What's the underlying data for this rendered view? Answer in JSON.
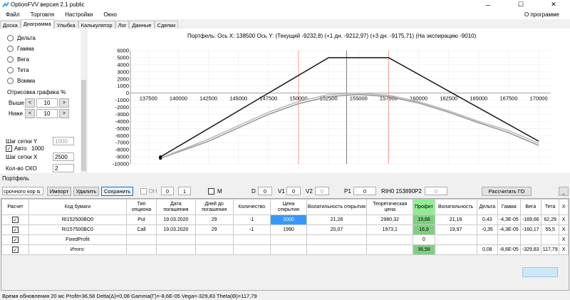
{
  "titlebar": {
    "title": "OptionFVV версия 2.1 public",
    "minimize": "─",
    "maximize": "☐",
    "close": "✕"
  },
  "menu": {
    "file": "Файл",
    "trade": "Торговля",
    "settings": "Настройки",
    "window": "Окно",
    "about": "О программе"
  },
  "tabs": [
    "Доска",
    "Диаграмма",
    "Улыбка",
    "Калькулятор",
    "Лог",
    "Данные",
    "Сделки"
  ],
  "left": {
    "radios": [
      "Дельта",
      "Гамма",
      "Вега",
      "Тета",
      "Вомма"
    ],
    "draw_title": "Отрисовка графика %",
    "above_label": "Выше",
    "above_value": "10",
    "below_label": "Ниже",
    "below_value": "10",
    "spin_left": "<",
    "spin_right": ">",
    "gridy_label": "Шаг сетки Y",
    "gridy_value": "1000",
    "auto_label": "Авто",
    "auto_value": "1000",
    "gridx_label": "Шаг сетки X",
    "gridx_value": "2500",
    "sko_label": "Кол-во СКО",
    "sko_value": "2"
  },
  "chart_title": "Портфель: Ось X: 138500 Ось Y: (Текущий -9232,8)  (+1 дн. -9212,97)  (+3 дн. -9175,71)  (На экспирацию -9010)",
  "chart_data": {
    "type": "line",
    "x_ticks": [
      137500,
      140000,
      142500,
      145000,
      147500,
      150000,
      152500,
      155000,
      157500,
      160000,
      162500,
      165000,
      167500,
      170000
    ],
    "y_ticks": [
      6000,
      5000,
      4000,
      3000,
      2000,
      1000,
      0,
      -1000,
      -2000,
      -3000,
      -4000,
      -5000,
      -6000,
      -7000,
      -8000,
      -9000,
      -10000
    ],
    "xlim": [
      136000,
      171000
    ],
    "ylim": [
      -10000,
      6000
    ],
    "cursor_x": 154000,
    "strike_lines": [
      150000,
      157500
    ],
    "series": [
      {
        "x": [
          138500,
          152500,
          157500,
          170000
        ],
        "y": [
          -9010,
          5000,
          5000,
          -6800
        ],
        "color": "#222222"
      },
      {
        "x": [
          138500,
          142500,
          147500,
          150000,
          152500,
          155000,
          157500,
          160000,
          162500,
          165000,
          167500,
          170000
        ],
        "y": [
          -9175,
          -6500,
          -2700,
          -1200,
          -200,
          0,
          -300,
          -1200,
          -2500,
          -4000,
          -5300,
          -7100
        ],
        "color": "#bbbbbb"
      },
      {
        "x": [
          138500,
          142500,
          147500,
          150000,
          152500,
          155000,
          157500,
          160000,
          162500,
          165000,
          167500,
          170000
        ],
        "y": [
          -9212,
          -6800,
          -3000,
          -1500,
          -500,
          -200,
          -500,
          -1400,
          -2700,
          -4200,
          -5600,
          -7400
        ],
        "color": "#999999"
      }
    ]
  },
  "portfolio": {
    "label": "Портфель",
    "combo": "срочного кор п",
    "import": "Импорт",
    "delete": "Удалить",
    "save": "Сохранить",
    "dh": "DH",
    "dh1": "0",
    "dh2": "1",
    "m": "M",
    "d_label": "D",
    "d_value": "0",
    "v1_label": "V1",
    "v1_value": "0",
    "v2_label": "V2",
    "v2_value": "0",
    "p1_label": "P1",
    "p1_value": "0",
    "rih": "RIH0 153890",
    "p2_label": "P2",
    "p2_value": "0",
    "calc": "Рассчитать ГО",
    "minbtn": "_"
  },
  "table": {
    "headers": [
      "Расчет",
      "Код бумаги",
      "Тип опциона",
      "Дата погашения",
      "Дней до погашения",
      "Количество",
      "Цена открытия",
      "Волатильность открытия",
      "Теоретическая цена",
      "Профит",
      "Волатильность",
      "Дельта",
      "Гамма",
      "Вега",
      "Тета",
      "X"
    ],
    "rows": [
      [
        "RI152500BO0",
        "Put",
        "19.03.2020",
        "29",
        "-1",
        "3000",
        "21,28",
        "2980,32",
        "19,68",
        "21,16",
        "0,43",
        "-4,3E-05",
        "-169,66",
        "62,29",
        "X"
      ],
      [
        "RI157500BC0",
        "Call",
        "19.03.2020",
        "29",
        "-1",
        "1990",
        "20,07",
        "1973,1",
        "16,9",
        "19,97",
        "-0,35",
        "-4,3E-05",
        "-160,17",
        "55,5",
        "X"
      ],
      [
        "FixedProfit",
        "",
        "",
        "",
        "",
        "",
        "",
        "",
        "0",
        "",
        "",
        "",
        "",
        "",
        "X"
      ],
      [
        "Итого:",
        "",
        "",
        "",
        "",
        "",
        "",
        "",
        "36,58",
        "",
        "0,08",
        "-8,6E-05",
        "-329,83",
        "117,79",
        "X"
      ]
    ]
  },
  "status": "Время обновления 20 мс  Profit=36,58 Delta(Δ)=0,08 Gamma(Γ)=-8,6E-05 Vega=-329,83 Theta(Θ)=117,79"
}
